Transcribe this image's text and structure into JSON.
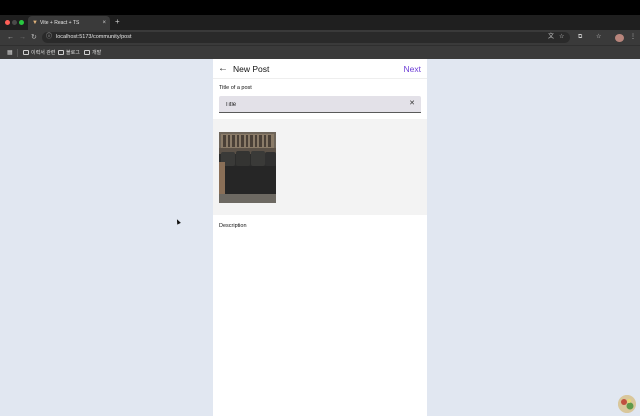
{
  "browser": {
    "tab_title": "Vite + React + TS",
    "tab_close": "×",
    "new_tab": "+",
    "url": "localhost:5173/community/post",
    "bookmarks": [
      "이력서 관련",
      "블로그",
      "개발"
    ]
  },
  "header": {
    "back_icon": "arrow-left-icon",
    "title": "New Post",
    "next_label": "Next"
  },
  "form": {
    "title_label": "Title of a post",
    "title_placeholder": "Title",
    "title_value": "",
    "clear_icon": "close-icon",
    "description_label": "Description",
    "description_value": ""
  },
  "colors": {
    "accent": "#6f3fd6",
    "page_background": "#e1e7f1",
    "input_fill": "#e3e1e8",
    "image_section": "#f3f3f3"
  }
}
